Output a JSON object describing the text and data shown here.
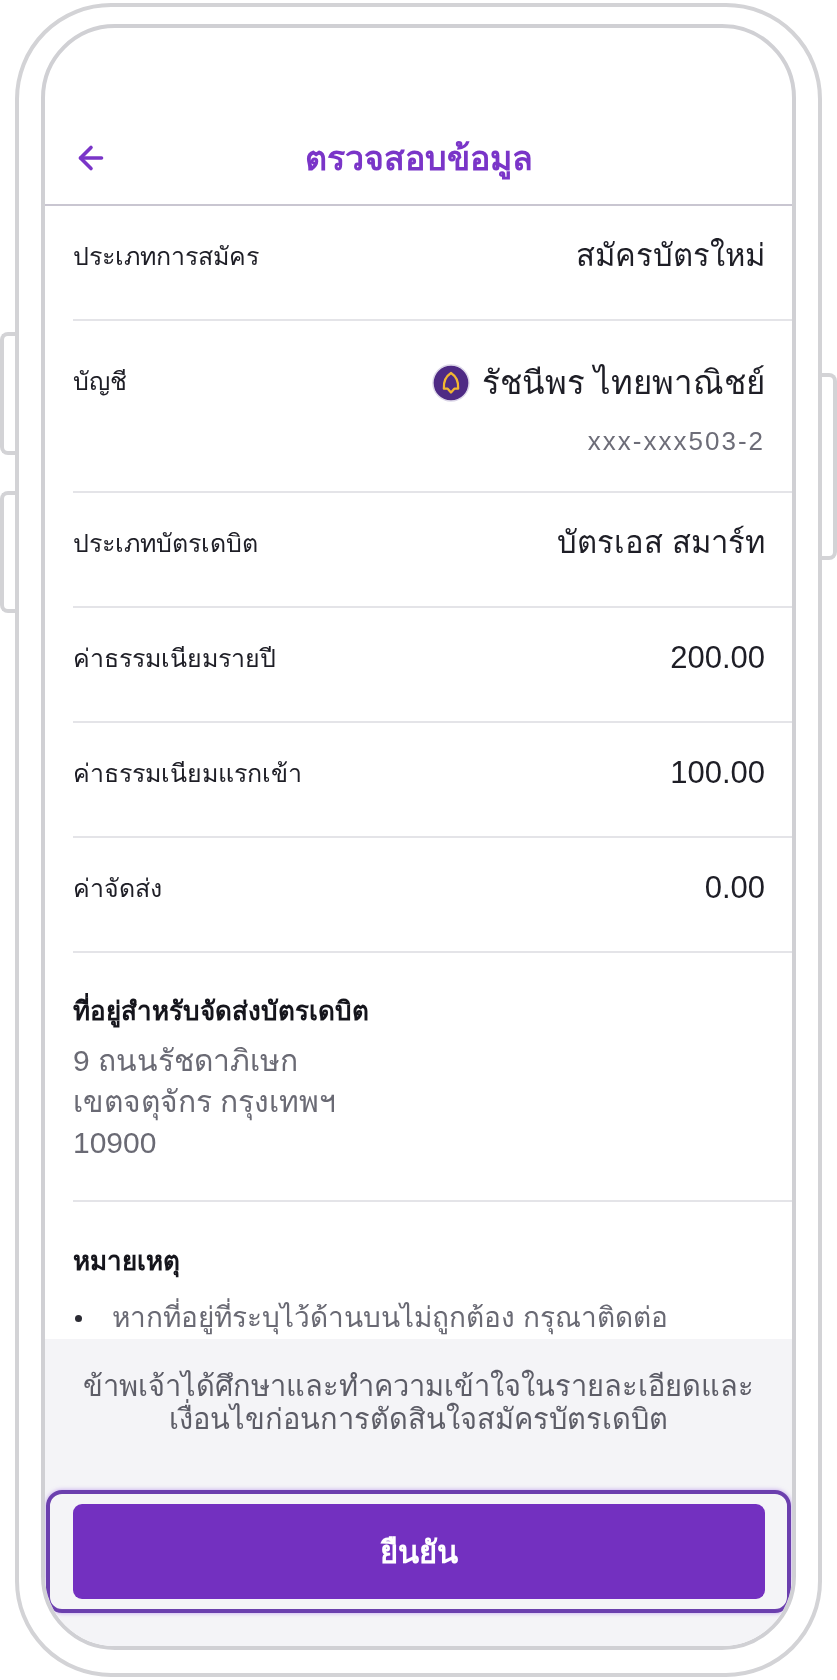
{
  "header": {
    "title": "ตรวจสอบข้อมูล"
  },
  "details": [
    {
      "kind": "text",
      "label": "ประเภทการสมัคร",
      "value": "สมัครบัตรใหม่"
    },
    {
      "kind": "account",
      "label": "บัญชี",
      "value": "รัชนีพร ไทยพาณิชย์",
      "sub_value": "xxx-xxx503-2"
    },
    {
      "kind": "text",
      "label": "ประเภทบัตรเดบิต",
      "value": "บัตรเอส สมาร์ท"
    },
    {
      "kind": "text",
      "label": "ค่าธรรมเนียมรายปี",
      "value": "200.00"
    },
    {
      "kind": "text",
      "label": "ค่าธรรมเนียมแรกเข้า",
      "value": "100.00"
    },
    {
      "kind": "text",
      "label": "ค่าจัดส่ง",
      "value": "0.00"
    }
  ],
  "address": {
    "title": "ที่อยู่สำหรับจัดส่งบัตรเดบิต",
    "lines": [
      "9 ถนนรัชดาภิเษก",
      "เขตจตุจักร กรุงเทพฯ",
      "10900"
    ]
  },
  "note": {
    "title": "หมายเหตุ",
    "items": [
      "หากที่อยู่ที่ระบุไว้ด้านบนไม่ถูกต้อง กรุณาติดต่อ"
    ]
  },
  "consent": "ข้าพเจ้าได้ศึกษาและทำความเข้าใจในรายละเอียดและเงื่อนไขก่อนการตัดสินใจสมัครบัตรเดบิต",
  "confirm_button": {
    "label": "ยืนยัน",
    "focused": true
  }
}
